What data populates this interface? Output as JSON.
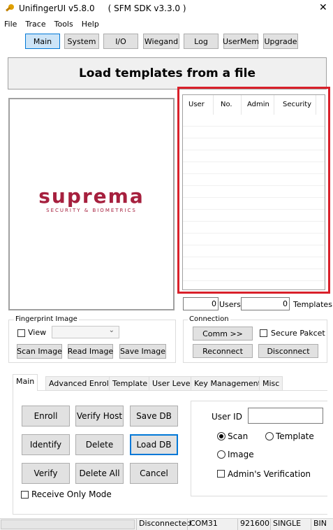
{
  "window": {
    "title": "UnifingerUI v5.8.0     ( SFM SDK v3.3.0 )",
    "close": "✕"
  },
  "menu": [
    "File",
    "Trace",
    "Tools",
    "Help"
  ],
  "toolbar": [
    "Main",
    "System",
    "I/O",
    "Wiegand",
    "Log",
    "UserMem",
    "Upgrade"
  ],
  "banner": "Load templates from a file",
  "logo": {
    "name": "suprema",
    "tagline": "SECURITY & BIOMETRICS",
    "color": "#a6203e"
  },
  "user_table": {
    "columns": [
      "User",
      "No.",
      "Admin",
      "Security"
    ],
    "rows": []
  },
  "counts": {
    "users_value": "0",
    "users_label": "Users",
    "templates_value": "0",
    "templates_label": "Templates"
  },
  "fingerprint": {
    "label": "Fingerprint Image",
    "view": "View",
    "scan": "Scan Image",
    "read": "Read Image",
    "save": "Save Image"
  },
  "connection": {
    "label": "Connection",
    "comm": "Comm >>",
    "secure": "Secure Pakcet",
    "reconnect": "Reconnect",
    "disconnect": "Disconnect"
  },
  "tabs": [
    "Main",
    "Advanced Enroll",
    "Template",
    "User Level",
    "Key Management",
    "Misc"
  ],
  "actions": {
    "enroll": "Enroll",
    "verify_host": "Verify Host",
    "save_db": "Save DB",
    "identify": "Identify",
    "delete": "Delete",
    "load_db": "Load DB",
    "verify": "Verify",
    "delete_all": "Delete All",
    "cancel": "Cancel"
  },
  "options": {
    "user_id_label": "User ID",
    "user_id_value": "",
    "scan": "Scan",
    "template": "Template",
    "image": "Image",
    "admin_verification": "Admin's Verification",
    "receive_only": "Receive Only Mode"
  },
  "status": {
    "state": "Disconnected",
    "port": "COM31",
    "baud": "921600",
    "mode": "SINGLE",
    "format": "BIN"
  },
  "colors": {
    "highlight_border": "#d9202a",
    "accent": "#0078d7"
  }
}
